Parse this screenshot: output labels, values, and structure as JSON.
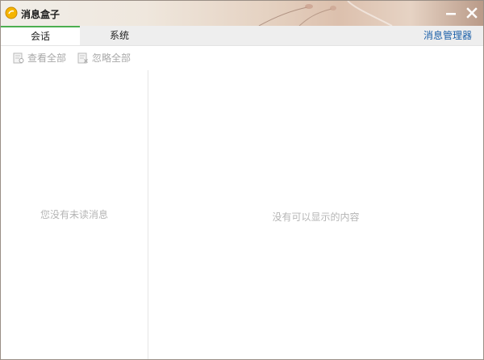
{
  "window": {
    "title": "消息盒子"
  },
  "tabs": [
    {
      "label": "会话",
      "active": true
    },
    {
      "label": "系统",
      "active": false
    }
  ],
  "header": {
    "manager_link": "消息管理器"
  },
  "toolbar": {
    "view_all": "查看全部",
    "ignore_all": "忽略全部"
  },
  "left_panel": {
    "empty_text": "您没有未读消息"
  },
  "right_panel": {
    "empty_text": "没有可以显示的内容"
  },
  "colors": {
    "accent_tab": "#4caf50",
    "link": "#1a5fa8",
    "muted_text": "#b5b5b5"
  },
  "icons": {
    "app": "message-box-icon",
    "minimize": "minimize-icon",
    "close": "close-icon",
    "view_all": "view-doc-icon",
    "ignore_all": "ignore-doc-icon"
  }
}
